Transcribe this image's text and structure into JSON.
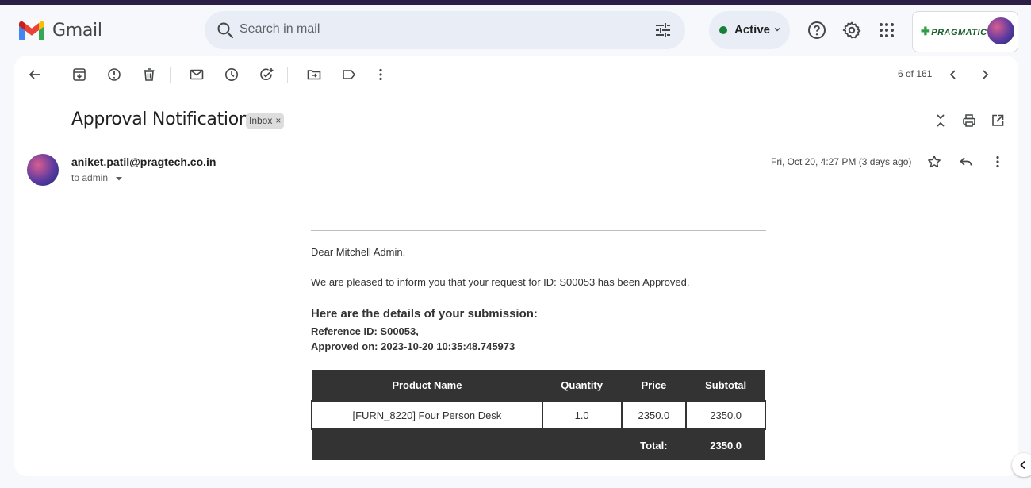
{
  "app": {
    "name": "Gmail"
  },
  "search": {
    "placeholder": "Search in mail"
  },
  "status": {
    "label": "Active",
    "color": "#188038"
  },
  "account": {
    "brand": "PRAGMATIC"
  },
  "toolbar": {
    "icons": [
      "back-arrow-icon",
      "archive-icon",
      "report-spam-icon",
      "delete-icon",
      "mark-unread-icon",
      "snooze-icon",
      "add-task-icon",
      "move-to-icon",
      "label-icon",
      "more-vert-icon"
    ],
    "pager": "6 of 161"
  },
  "email": {
    "subject": "Approval Notification",
    "badge": "Inbox",
    "badge_close": "×",
    "sender": "aniket.patil@pragtech.co.in",
    "to": "to admin",
    "date": "Fri, Oct 20, 4:27 PM (3 days ago)",
    "greeting": "Dear Mitchell Admin,",
    "message": "We are pleased to inform you that your request for ID: S00053 has been Approved.",
    "details_heading": "Here are the details of your submission:",
    "reference": "Reference ID: S00053,",
    "approved_on": "Approved on: 2023-10-20 10:35:48.745973",
    "table": {
      "headers": [
        "Product Name",
        "Quantity",
        "Price",
        "Subtotal"
      ],
      "rows": [
        [
          "[FURN_8220] Four Person Desk",
          "1.0",
          "2350.0",
          "2350.0"
        ]
      ],
      "total_label": "Total:",
      "total_value": "2350.0"
    }
  }
}
